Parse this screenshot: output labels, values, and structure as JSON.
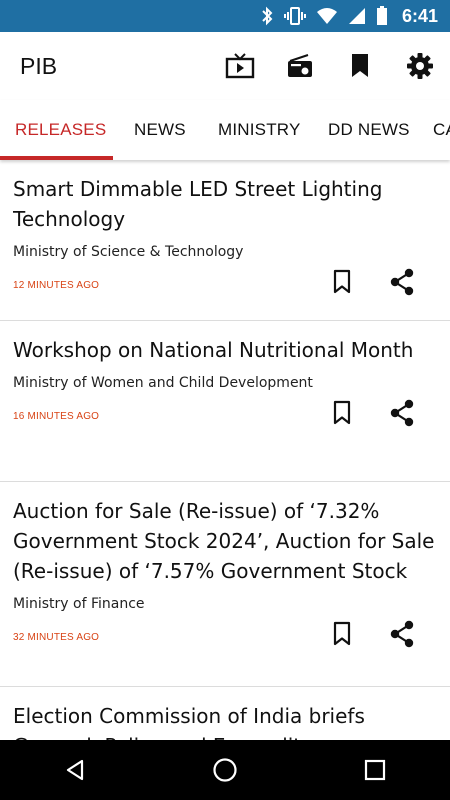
{
  "status_bar": {
    "time": "6:41",
    "bg_color": "#1f6fa3"
  },
  "app_bar": {
    "title": "PIB",
    "actions": [
      "tv-icon",
      "radio-icon",
      "bookmark-icon",
      "settings-icon"
    ]
  },
  "tabs": {
    "items": [
      {
        "label": "RELEASES",
        "active": true
      },
      {
        "label": "NEWS",
        "active": false
      },
      {
        "label": "MINISTRY",
        "active": false
      },
      {
        "label": "DD NEWS",
        "active": false
      },
      {
        "label": "CA",
        "active": false
      }
    ],
    "active_color": "#c62828"
  },
  "releases": [
    {
      "title": "Smart Dimmable LED Street Lighting Technology",
      "ministry": "Ministry of Science & Technology",
      "time": "12 MINUTES AGO"
    },
    {
      "title": "Workshop on National Nutritional Month",
      "ministry": "Ministry of Women and Child Development",
      "time": "16 MINUTES AGO"
    },
    {
      "title": "Auction for Sale (Re-issue) of ‘7.32% Government Stock 2024’, Auction for Sale (Re-issue) of ‘7.57% Government Stock",
      "ministry": "Ministry of Finance",
      "time": "32 MINUTES AGO"
    },
    {
      "title": "Election Commission of India briefs General, Police and Expenditure",
      "ministry": "",
      "time": ""
    }
  ],
  "colors": {
    "time_text": "#d84315",
    "divider": "#dcdcdc"
  }
}
